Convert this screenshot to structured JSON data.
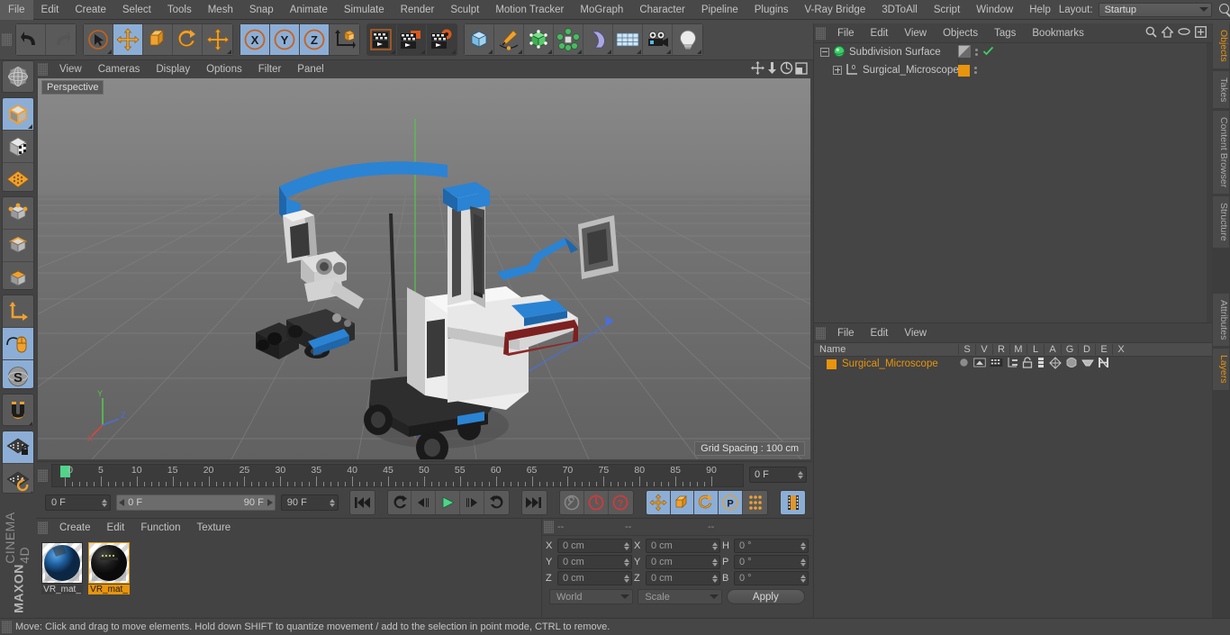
{
  "app": {
    "title": "CINEMA 4D",
    "brand_line1": "MAXON",
    "brand_line2": "CINEMA 4D"
  },
  "menubar": {
    "items": [
      "File",
      "Edit",
      "Create",
      "Select",
      "Tools",
      "Mesh",
      "Snap",
      "Animate",
      "Simulate",
      "Render",
      "Sculpt",
      "Motion Tracker",
      "MoGraph",
      "Character",
      "Pipeline",
      "Plugins",
      "V-Ray Bridge",
      "3DToAll",
      "Script",
      "Window",
      "Help"
    ],
    "layout_label": "Layout:",
    "layout_value": "Startup",
    "search_icon": "magnifier-icon"
  },
  "toolbar": {
    "undo": "undo-icon",
    "redo": "redo-icon",
    "select": "live-selection-icon",
    "move": "move-tool-icon",
    "scale": "scale-tool-icon",
    "rotate": "rotate-tool-icon",
    "move_alt": "move-axis-icon",
    "axis_x": "X",
    "axis_y": "Y",
    "axis_z": "Z",
    "world_axis": "world-coordinate-icon",
    "render_view": "render-view-icon",
    "render_region": "render-region-icon",
    "render_settings": "render-settings-icon",
    "primitive": "cube-primitive-icon",
    "spline": "pen-spline-icon",
    "generator": "nurbs-generator-icon",
    "deformer": "array-deformer-icon",
    "bend": "bend-deformer-icon",
    "scene": "floor-environment-icon",
    "camera": "camera-icon",
    "light": "light-icon"
  },
  "leftbar": {
    "items": [
      {
        "name": "world-grid-icon",
        "selected": false
      },
      {
        "name": "model-mode-icon",
        "selected": true
      },
      {
        "name": "texture-mode-icon",
        "selected": false
      },
      {
        "name": "workplane-icon",
        "selected": false
      },
      {
        "name": "point-mode-icon",
        "selected": false
      },
      {
        "name": "edge-mode-icon",
        "selected": false
      },
      {
        "name": "polygon-mode-icon",
        "selected": false
      },
      {
        "name": "axis-mode-icon",
        "selected": false
      },
      {
        "name": "enable-tweak-icon",
        "selected": true
      },
      {
        "name": "soft-selection-icon",
        "selected": true
      },
      {
        "name": "snap-magnet-icon",
        "selected": false
      },
      {
        "name": "workplane-lock-icon",
        "selected": true
      },
      {
        "name": "workplane-reset-icon",
        "selected": false
      }
    ]
  },
  "viewport": {
    "menu": [
      "View",
      "Cameras",
      "Display",
      "Options",
      "Filter",
      "Panel"
    ],
    "label": "Perspective",
    "grid_spacing": "Grid Spacing : 100 cm",
    "nav_icons": [
      "pan-icon",
      "dolly-icon",
      "orbit-icon",
      "maximize-icon"
    ],
    "axis_labels": {
      "x": "X",
      "y": "Y",
      "z": "Z"
    },
    "scene_description": "Surgical microscope 3D model on mobile cart"
  },
  "timeline": {
    "ticks": [
      0,
      5,
      10,
      15,
      20,
      25,
      30,
      35,
      40,
      45,
      50,
      55,
      60,
      65,
      70,
      75,
      80,
      85,
      90
    ],
    "current_frame_display": "0 F",
    "start_field": "0 F",
    "range_start": "0 F",
    "range_end": "90 F",
    "end_field": "90 F",
    "playhead_frame": 0,
    "buttons": [
      {
        "name": "goto-start-button",
        "glyph": "|<<"
      },
      {
        "name": "prev-key-button",
        "glyph": "key-prev"
      },
      {
        "name": "prev-frame-button",
        "glyph": "<|"
      },
      {
        "name": "play-button",
        "glyph": "play"
      },
      {
        "name": "next-frame-button",
        "glyph": "|>"
      },
      {
        "name": "next-key-button",
        "glyph": "key-next"
      },
      {
        "name": "goto-end-button",
        "glyph": ">>|"
      },
      {
        "name": "record-active-objects-button",
        "glyph": "record-key"
      },
      {
        "name": "autokeying-button",
        "glyph": "autokey"
      },
      {
        "name": "keyframe-selection-button",
        "glyph": "keyselect"
      },
      {
        "name": "record-position-button",
        "glyph": "pos"
      },
      {
        "name": "record-scale-button",
        "glyph": "scale"
      },
      {
        "name": "record-rotation-button",
        "glyph": "rot"
      },
      {
        "name": "record-param-button",
        "glyph": "P"
      },
      {
        "name": "record-pla-button",
        "glyph": "pla"
      },
      {
        "name": "timeline-filmstrip-button",
        "glyph": "film"
      }
    ]
  },
  "material_manager": {
    "menu": [
      "Create",
      "Edit",
      "Function",
      "Texture"
    ],
    "materials": [
      {
        "name": "VR_mat_",
        "selected": false
      },
      {
        "name": "VR_mat_",
        "selected": true
      }
    ]
  },
  "coordinates": {
    "headers": [
      "--",
      "--",
      "--"
    ],
    "position": {
      "x_label": "X",
      "x": "0 cm",
      "y_label": "Y",
      "y": "0 cm",
      "z_label": "Z",
      "z": "0 cm"
    },
    "size": {
      "x_label": "X",
      "x": "0 cm",
      "y_label": "Y",
      "y": "0 cm",
      "z_label": "Z",
      "z": "0 cm"
    },
    "rotation": {
      "h_label": "H",
      "h": "0 °",
      "p_label": "P",
      "p": "0 °",
      "b_label": "B",
      "b": "0 °"
    },
    "system_select": "World",
    "mode_select": "Scale",
    "apply_label": "Apply"
  },
  "object_manager": {
    "menu": [
      "File",
      "Edit",
      "View",
      "Objects",
      "Tags",
      "Bookmarks"
    ],
    "toolbar_icons": [
      "search-icon",
      "home-icon",
      "ellipse-icon",
      "add-layer-icon"
    ],
    "objects": [
      {
        "name": "Subdivision Surface",
        "icon": "subdivision-surface-icon",
        "depth": 0,
        "tag_color": "#9a9a9a",
        "enabled_check": "✓"
      },
      {
        "name": "Surgical_Microscope",
        "icon": "null-object-icon",
        "depth": 1,
        "tag_color": "#e8940c",
        "enabled_check": ""
      }
    ]
  },
  "layer_manager": {
    "menu": [
      "File",
      "Edit",
      "View"
    ],
    "columns": [
      "Name",
      "S",
      "V",
      "R",
      "M",
      "L",
      "A",
      "G",
      "D",
      "E",
      "X"
    ],
    "rows": [
      {
        "name": "Surgical_Microscope",
        "color": "#e8940c",
        "icons": [
          "solo-icon",
          "view-icon",
          "render-icon",
          "manager-icon",
          "lock-icon",
          "animation-icon",
          "generator-icon",
          "deformer-icon",
          "expression-icon",
          "xref-icon"
        ]
      }
    ]
  },
  "right_tabs": [
    {
      "label": "Objects",
      "active": true
    },
    {
      "label": "Takes",
      "active": false
    },
    {
      "label": "Content Browser",
      "active": false
    },
    {
      "label": "Structure",
      "active": false
    },
    {
      "label": "Attributes",
      "active": false
    },
    {
      "label": "Layers",
      "active": true
    }
  ],
  "statusbar": {
    "text": "Move: Click and drag to move elements. Hold down SHIFT to quantize movement / add to the selection in point mode, CTRL to remove."
  },
  "colors": {
    "accent_orange": "#e8940c",
    "selected_blue": "#8caed6",
    "panel_bg": "#434343",
    "viewport_bg": "#6f6f6f",
    "green_playhead": "#4fd48a"
  }
}
